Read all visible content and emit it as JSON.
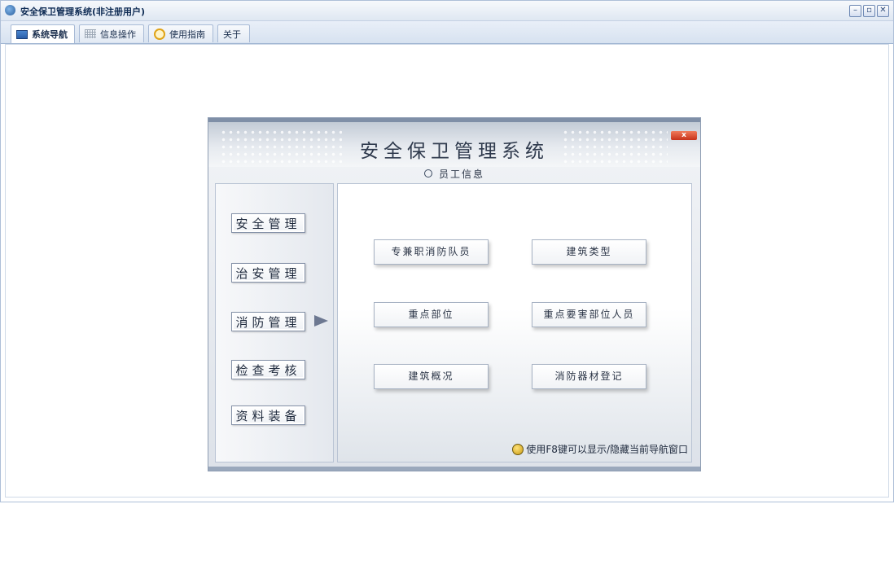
{
  "window": {
    "title": "安全保卫管理系统(非注册用户)",
    "controls": {
      "minimize": "–",
      "restore": "▫",
      "close": "✕"
    }
  },
  "tabs": [
    {
      "label": "系统导航",
      "icon": "monitor-icon",
      "active": true
    },
    {
      "label": "信息操作",
      "icon": "grid-icon",
      "active": false
    },
    {
      "label": "使用指南",
      "icon": "help-icon",
      "active": false
    },
    {
      "label": "关于",
      "icon": "",
      "active": false
    }
  ],
  "dialog": {
    "title": "安全保卫管理系统",
    "close_label": "x",
    "section": "员工信息",
    "categories": [
      "安全管理",
      "治安管理",
      "消防管理",
      "检查考核",
      "资料装备"
    ],
    "selected_category": "消防管理",
    "items": [
      "专兼职消防队员",
      "建筑类型",
      "重点部位",
      "重点要害部位人员",
      "建筑概况",
      "消防器材登记"
    ],
    "hint": "使用F8键可以显示/隐藏当前导航窗口"
  },
  "colors": {
    "title_text": "#0d2a53",
    "tab_bg": "#dfe7f2",
    "dialog_frame": "#7f8fa7",
    "close_button": "#d9452a"
  }
}
